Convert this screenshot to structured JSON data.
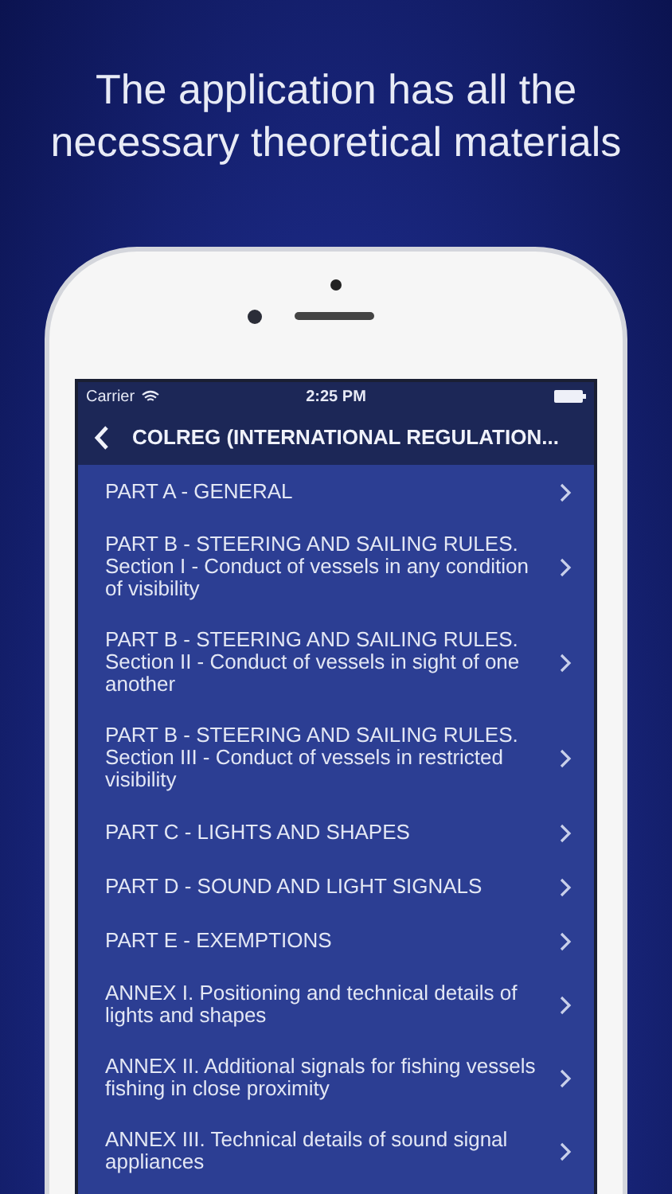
{
  "headline": "The application has all the necessary theoretical materials",
  "status_bar": {
    "carrier": "Carrier",
    "time": "2:25 PM"
  },
  "nav": {
    "title": "COLREG (INTERNATIONAL REGULATION..."
  },
  "items": [
    {
      "label": "PART A - GENERAL"
    },
    {
      "label": "PART B - STEERING AND SAILING RULES. Section I - Conduct of vessels in any condition of visibility"
    },
    {
      "label": "PART B - STEERING AND SAILING RULES. Section II - Conduct of vessels in sight of one another"
    },
    {
      "label": "PART B - STEERING AND SAILING RULES. Section III - Conduct of vessels in restricted visibility"
    },
    {
      "label": "PART C - LIGHTS AND SHAPES"
    },
    {
      "label": "PART D - SOUND AND LIGHT SIGNALS"
    },
    {
      "label": "PART E - EXEMPTIONS"
    },
    {
      "label": "ANNEX I. Positioning and technical details of lights and shapes"
    },
    {
      "label": "ANNEX II. Additional signals for fishing vessels fishing in close proximity"
    },
    {
      "label": "ANNEX III. Technical details of sound signal appliances"
    }
  ]
}
